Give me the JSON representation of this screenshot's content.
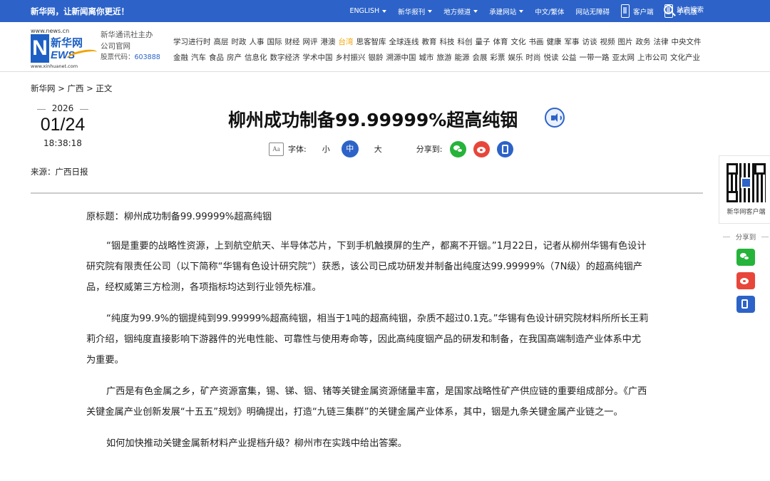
{
  "topbar": {
    "slogan": "新华网，让新闻离你更近！",
    "nav": [
      "ENGLISH",
      "新华报刊",
      "地方频道",
      "承建网站",
      "中文/繁体",
      "网站无障碍",
      "客户端",
      "手机版"
    ],
    "search": "站内搜索"
  },
  "header": {
    "logo_url": "www.news.cn",
    "logo_cn": "新华网",
    "logo_en": "EWS",
    "logo_letter": "N",
    "logo_url2": "www.xinhuanet.com",
    "company_line1": "新华通讯社主办",
    "company_line2": "公司官网",
    "stock_label": "股票代码：",
    "stock_code": "603888",
    "channels_row1": [
      "学习进行时",
      "高层",
      "时政",
      "人事",
      "国际",
      "财经",
      "网评",
      "港澳",
      "台湾",
      "思客智库",
      "全球连线",
      "教育",
      "科技",
      "科创",
      "量子",
      "体育",
      "文化",
      "书画",
      "健康",
      "军事",
      "访谈",
      "视频",
      "图片",
      "政务",
      "法律",
      "中央文件"
    ],
    "channels_row2": [
      "金融",
      "汽车",
      "食品",
      "房产",
      "信息化",
      "数字经济",
      "学术中国",
      "乡村振兴",
      "银龄",
      "溯源中国",
      "城市",
      "旅游",
      "能源",
      "会展",
      "彩票",
      "娱乐",
      "时尚",
      "悦读",
      "公益",
      "一带一路",
      "亚太网",
      "上市公司",
      "文化产业"
    ],
    "highlight_channel": "台湾"
  },
  "breadcrumb": "新华网 > 广西 > 正文",
  "date": {
    "year": "2026",
    "month_day": "01/24",
    "time": "18:38:18"
  },
  "source": "来源：广西日报",
  "article": {
    "title": "柳州成功制备99.99999%超高纯铟",
    "font_label": "字体:",
    "font_icon_text": "Aa",
    "size_small": "小",
    "size_medium": "中",
    "size_large": "大",
    "share_label": "分享到:",
    "paragraphs": [
      "原标题：柳州成功制备99.99999%超高纯铟",
      "“铟是重要的战略性资源，上到航空航天、半导体芯片，下到手机触摸屏的生产，都离不开铟。”1月22日，记者从柳州华锡有色设计研究院有限责任公司（以下简称“华锡有色设计研究院”）获悉，该公司已成功研发并制备出纯度达99.99999%（7N级）的超高纯铟产品，经权威第三方检测，各项指标均达到行业领先标准。",
      "“纯度为99.9%的铟提纯到99.99999%超高纯铟，相当于1吨的超高纯铟，杂质不超过0.1克。”华锡有色设计研究院材料所所长王莉莉介绍，铟纯度直接影响下游器件的光电性能、可靠性与使用寿命等，因此高纯度铟产品的研发和制备，在我国高端制造产业体系中尤为重要。",
      "广西是有色金属之乡，矿产资源富集，锡、锑、铟、锗等关键金属资源储量丰富，是国家战略性矿产供应链的重要组成部分。《广西关键金属产业创新发展“十五五”规划》明确提出，打造“九链三集群”的关键金属产业体系，其中，铟是九条关键金属产业链之一。",
      "如何加快推动关键金属新材料产业提档升级？柳州市在实践中给出答案。"
    ]
  },
  "side": {
    "qr_label": "新华网客户端",
    "share_label": "分享到"
  },
  "colors": {
    "brand_blue": "#2d63c8",
    "wechat_green": "#26b33a",
    "weibo_red": "#e8463a",
    "highlight_orange": "#f2a300"
  }
}
